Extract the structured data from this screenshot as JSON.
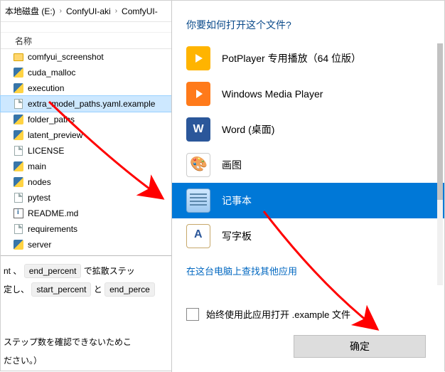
{
  "breadcrumb": {
    "seg0": "本地磁盘 (E:)",
    "seg1": "ConfyUI-aki",
    "seg2": "ComfyUI-"
  },
  "filelist": {
    "header": "名称",
    "items": [
      {
        "icon": "folder",
        "label": "comfyui_screenshot"
      },
      {
        "icon": "py",
        "label": "cuda_malloc"
      },
      {
        "icon": "py",
        "label": "execution"
      },
      {
        "icon": "file",
        "label": "extra_model_paths.yaml.example",
        "selected": true
      },
      {
        "icon": "py",
        "label": "folder_paths"
      },
      {
        "icon": "py",
        "label": "latent_preview"
      },
      {
        "icon": "file",
        "label": "LICENSE"
      },
      {
        "icon": "py",
        "label": "main"
      },
      {
        "icon": "py",
        "label": "nodes"
      },
      {
        "icon": "file",
        "label": "pytest"
      },
      {
        "icon": "md",
        "label": "README.md"
      },
      {
        "icon": "file",
        "label": "requirements"
      },
      {
        "icon": "py",
        "label": "server"
      }
    ]
  },
  "snippet": {
    "line1_a": "nt 、",
    "chip1": "end_percent",
    "line1_b": "で拡散ステッ",
    "line2_a": "定し、",
    "chip2": "start_percent",
    "line2_b": "と",
    "chip3": "end_perce",
    "line3": "ステップ数を確認できないためこ",
    "line4": "ださい。）"
  },
  "dialog": {
    "title": "你要如何打开这个文件?",
    "apps": [
      {
        "icon": "potplayer",
        "label": "PotPlayer 专用播放（64 位版）"
      },
      {
        "icon": "wmp",
        "label": "Windows Media Player"
      },
      {
        "icon": "word",
        "label": "Word (桌面)"
      },
      {
        "icon": "paint",
        "label": "画图"
      },
      {
        "icon": "notepad",
        "label": "记事本",
        "selected": true
      },
      {
        "icon": "wordpad",
        "label": "写字板"
      }
    ],
    "more_link": "在这台电脑上查找其他应用",
    "always_label": "始终使用此应用打开 .example 文件",
    "ok_label": "确定"
  }
}
